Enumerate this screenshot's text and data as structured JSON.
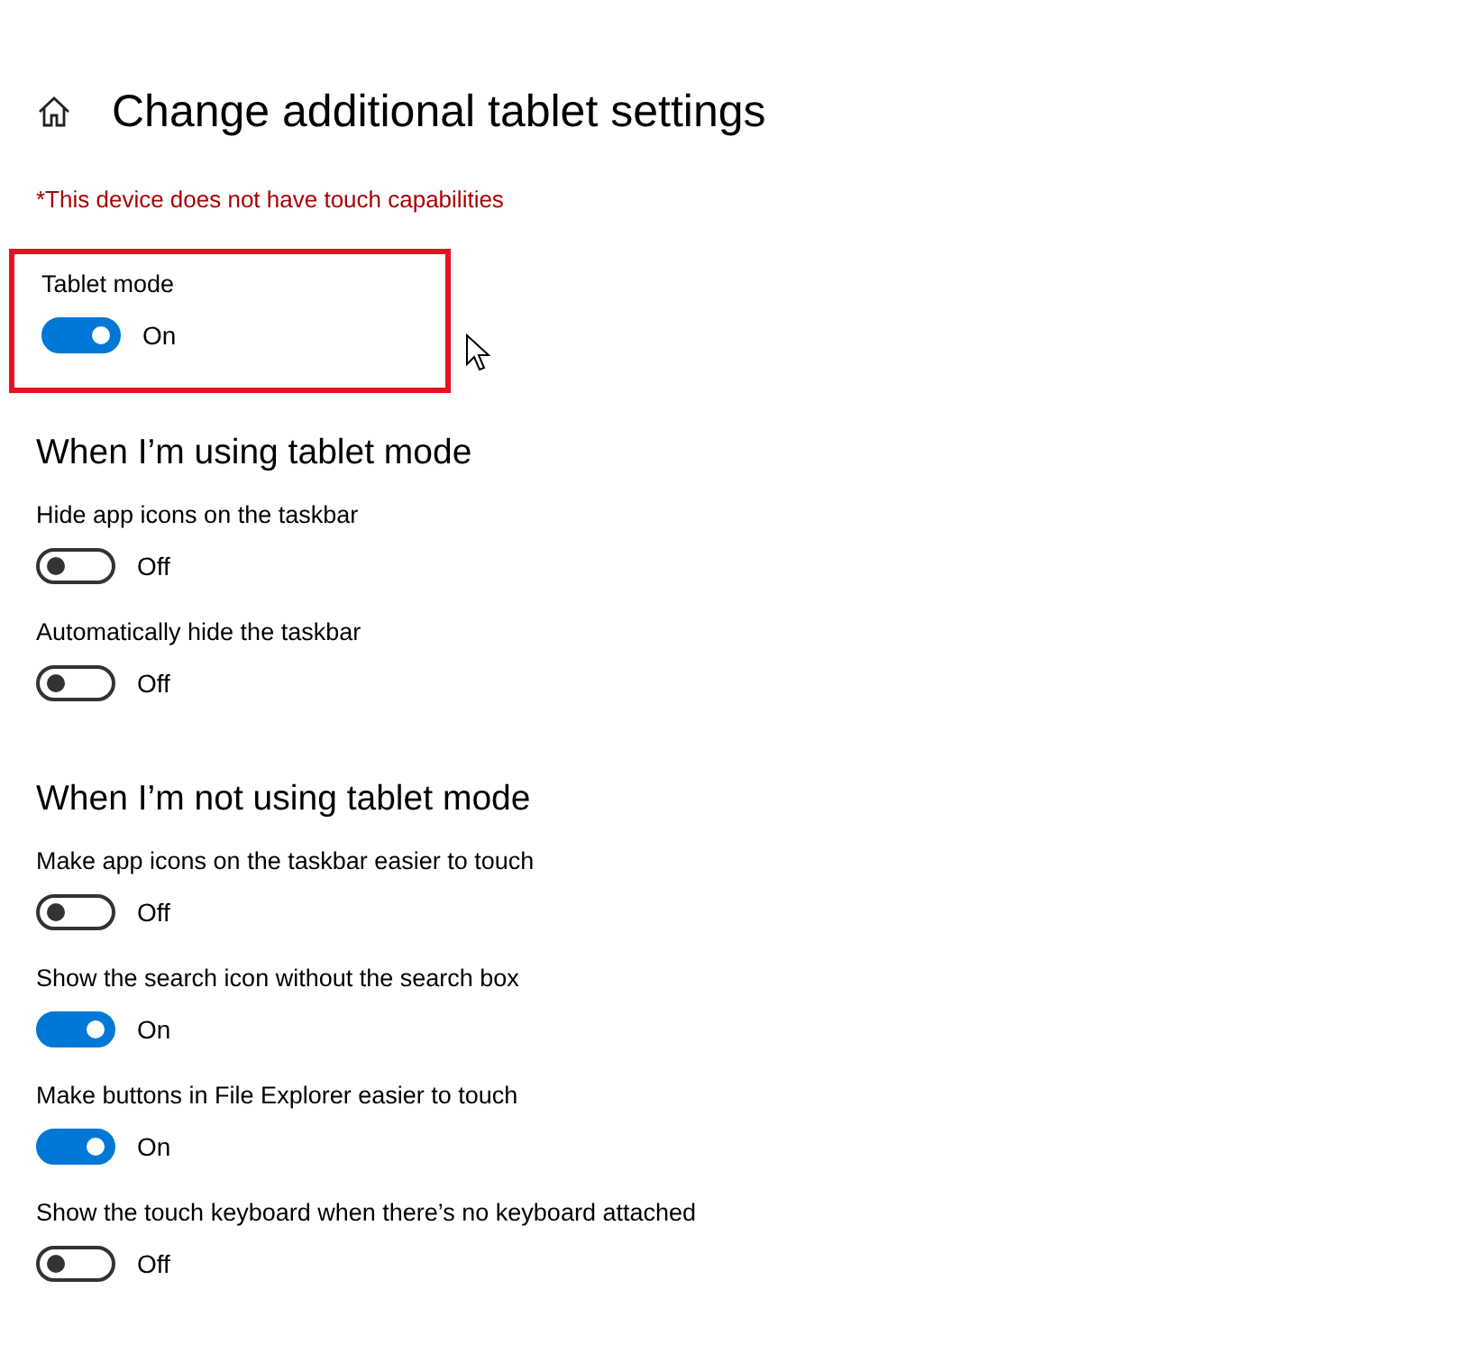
{
  "title": "Change additional tablet settings",
  "warning": "*This device does not have touch capabilities",
  "tablet_mode": {
    "label": "Tablet mode",
    "on": true,
    "status": "On",
    "highlighted": true
  },
  "sections": [
    {
      "heading": "When I’m using tablet mode",
      "settings": [
        {
          "label": "Hide app icons on the taskbar",
          "on": false,
          "status": "Off"
        },
        {
          "label": "Automatically hide the taskbar",
          "on": false,
          "status": "Off"
        }
      ]
    },
    {
      "heading": "When I’m not using tablet mode",
      "settings": [
        {
          "label": "Make app icons on the taskbar easier to touch",
          "on": false,
          "status": "Off"
        },
        {
          "label": "Show the search icon without the search box",
          "on": true,
          "status": "On"
        },
        {
          "label": "Make buttons in File Explorer easier to touch",
          "on": true,
          "status": "On"
        },
        {
          "label": "Show the touch keyboard when there’s no keyboard attached",
          "on": false,
          "status": "Off"
        }
      ]
    }
  ]
}
